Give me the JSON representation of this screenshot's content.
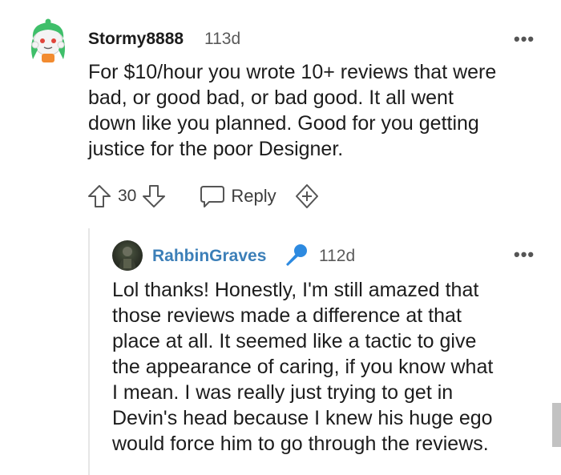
{
  "comment": {
    "username": "Stormy8888",
    "age": "113d",
    "body": "For $10/hour you wrote 10+ reviews that were\nbad, or good bad, or bad good. It all went\ndown like you planned. Good for you getting\njustice for the poor Designer.",
    "vote_count": "30",
    "reply_label": "Reply",
    "menu": "•••"
  },
  "reply": {
    "username": "RahbinGraves",
    "age": "112d",
    "body": "Lol thanks! Honestly, I'm still amazed that\nthose reviews made a difference at that\nplace at all. It seemed like a tactic to give\nthe appearance of caring, if you know what\nI mean. I was really just trying to get in\nDevin's head because I knew his huge ego\nwould force him to go through the reviews.",
    "menu": "•••",
    "flair_icon": "microphone-icon"
  },
  "colors": {
    "username_reply": "#3c7fb8",
    "mic_icon": "#2d8ae0",
    "avatar_accent": "#3fbf6a"
  }
}
